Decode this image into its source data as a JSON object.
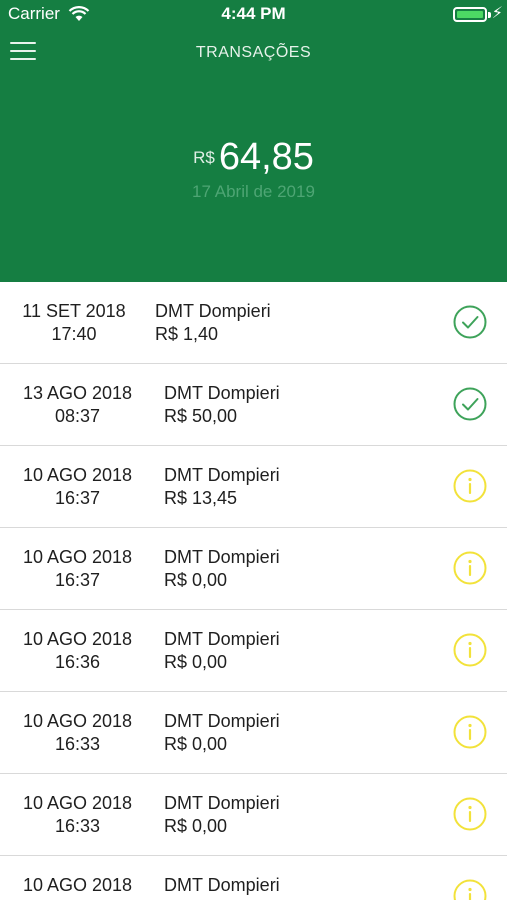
{
  "status_bar": {
    "carrier": "Carrier",
    "time": "4:44 PM"
  },
  "header": {
    "title": "TRANSAÇÕES",
    "currency": "R$",
    "balance": "64,85",
    "date": "17 Abril de 2019",
    "background_color": "#157e42"
  },
  "colors": {
    "success": "#3ea35a",
    "pending": "#f2e23a"
  },
  "transactions": [
    {
      "date": "11 SET 2018",
      "time": "17:40",
      "merchant": "DMT Dompieri",
      "amount": "R$ 1,40",
      "status": "check-circle-icon"
    },
    {
      "date": "13 AGO 2018",
      "time": "08:37",
      "merchant": "DMT Dompieri",
      "amount": "R$ 50,00",
      "status": "check-circle-icon"
    },
    {
      "date": "10 AGO 2018",
      "time": "16:37",
      "merchant": "DMT Dompieri",
      "amount": "R$ 13,45",
      "status": "info-circle-icon"
    },
    {
      "date": "10 AGO 2018",
      "time": "16:37",
      "merchant": "DMT Dompieri",
      "amount": "R$ 0,00",
      "status": "info-circle-icon"
    },
    {
      "date": "10 AGO 2018",
      "time": "16:36",
      "merchant": "DMT Dompieri",
      "amount": "R$ 0,00",
      "status": "info-circle-icon"
    },
    {
      "date": "10 AGO 2018",
      "time": "16:33",
      "merchant": "DMT Dompieri",
      "amount": "R$ 0,00",
      "status": "info-circle-icon"
    },
    {
      "date": "10 AGO 2018",
      "time": "16:33",
      "merchant": "DMT Dompieri",
      "amount": "R$ 0,00",
      "status": "info-circle-icon"
    },
    {
      "date": "10 AGO 2018",
      "time": "",
      "merchant": "DMT Dompieri",
      "amount": "",
      "status": "info-circle-icon"
    }
  ]
}
